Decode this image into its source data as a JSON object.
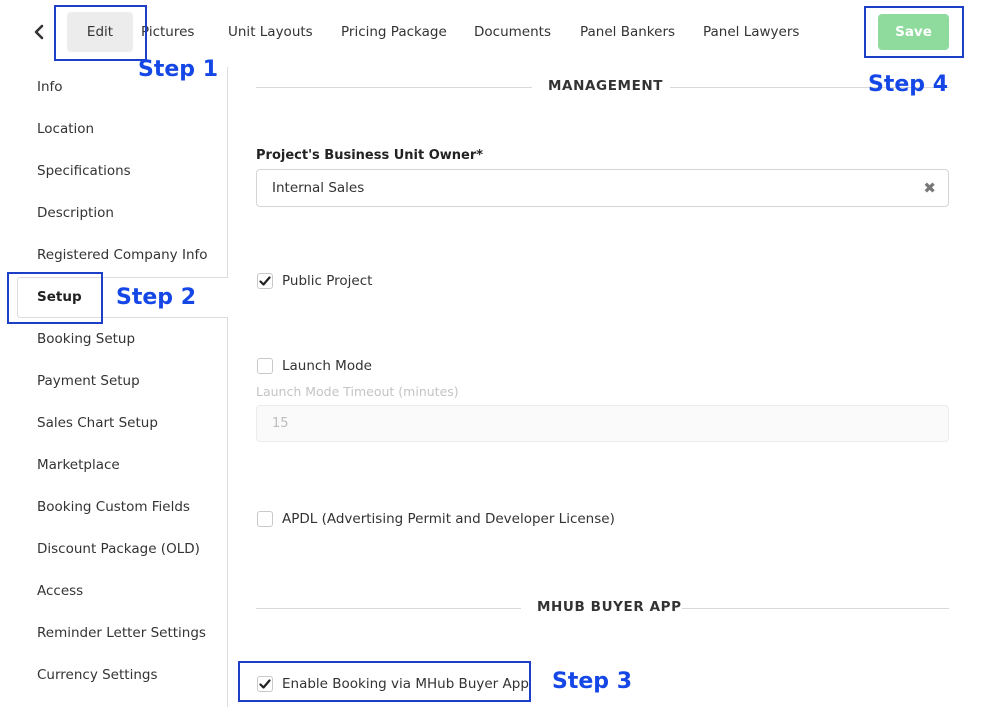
{
  "nav": {
    "tabs": [
      {
        "label": "Edit"
      },
      {
        "label": "Pictures"
      },
      {
        "label": "Unit Layouts"
      },
      {
        "label": "Pricing Package"
      },
      {
        "label": "Documents"
      },
      {
        "label": "Panel Bankers"
      },
      {
        "label": "Panel Lawyers"
      }
    ],
    "save_label": "Save",
    "back_icon": "chevron-left-icon"
  },
  "annotations": {
    "step1": "Step 1",
    "step2": "Step 2",
    "step3": "Step 3",
    "step4": "Step 4",
    "color": "#1447e6"
  },
  "sidebar": {
    "items": [
      {
        "label": "Info"
      },
      {
        "label": "Location"
      },
      {
        "label": "Specifications"
      },
      {
        "label": "Description"
      },
      {
        "label": "Registered Company Info"
      },
      {
        "label": "Setup"
      },
      {
        "label": "Booking Setup"
      },
      {
        "label": "Payment Setup"
      },
      {
        "label": "Sales Chart Setup"
      },
      {
        "label": "Marketplace"
      },
      {
        "label": "Booking Custom Fields"
      },
      {
        "label": "Discount Package (OLD)"
      },
      {
        "label": "Access"
      },
      {
        "label": "Reminder Letter Settings"
      },
      {
        "label": "Currency Settings"
      }
    ],
    "active": "Setup"
  },
  "main": {
    "management": {
      "title": "MANAGEMENT",
      "owner_label": "Project's Business Unit Owner*",
      "owner_value": "Internal Sales",
      "public_project": {
        "label": "Public Project",
        "checked": true
      },
      "launch_mode": {
        "label": "Launch Mode",
        "checked": false
      },
      "launch_timeout_label": "Launch Mode Timeout (minutes)",
      "launch_timeout_value": "15",
      "apdl": {
        "label": "APDL (Advertising Permit and Developer License)",
        "checked": false
      }
    },
    "buyer_app": {
      "title": "MHUB BUYER APP",
      "enable_booking": {
        "label": "Enable Booking via MHub Buyer App",
        "checked": true
      }
    }
  },
  "colors": {
    "save_button": "#8fdb9e",
    "annotation_border": "#1c3fc7"
  }
}
